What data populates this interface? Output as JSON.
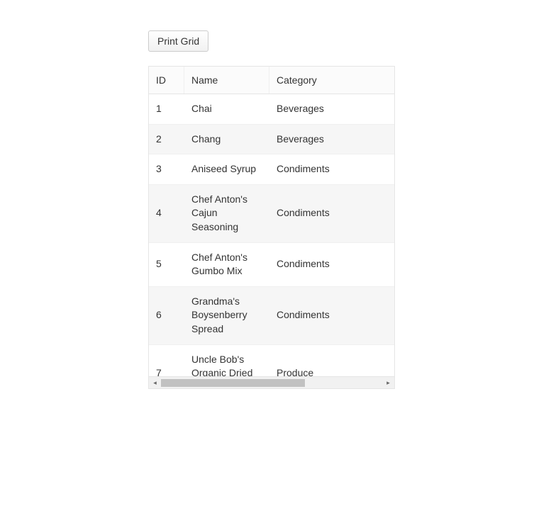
{
  "toolbar": {
    "print_label": "Print Grid"
  },
  "grid": {
    "columns": [
      {
        "key": "id",
        "label": "ID"
      },
      {
        "key": "name",
        "label": "Name"
      },
      {
        "key": "category",
        "label": "Category"
      }
    ],
    "rows": [
      {
        "id": "1",
        "name": "Chai",
        "category": "Beverages"
      },
      {
        "id": "2",
        "name": "Chang",
        "category": "Beverages"
      },
      {
        "id": "3",
        "name": "Aniseed Syrup",
        "category": "Condiments"
      },
      {
        "id": "4",
        "name": "Chef Anton's Cajun Seasoning",
        "category": "Condiments"
      },
      {
        "id": "5",
        "name": "Chef Anton's Gumbo Mix",
        "category": "Condiments"
      },
      {
        "id": "6",
        "name": "Grandma's Boysenberry Spread",
        "category": "Condiments"
      },
      {
        "id": "7",
        "name": "Uncle Bob's Organic Dried Pears",
        "category": "Produce"
      }
    ]
  }
}
